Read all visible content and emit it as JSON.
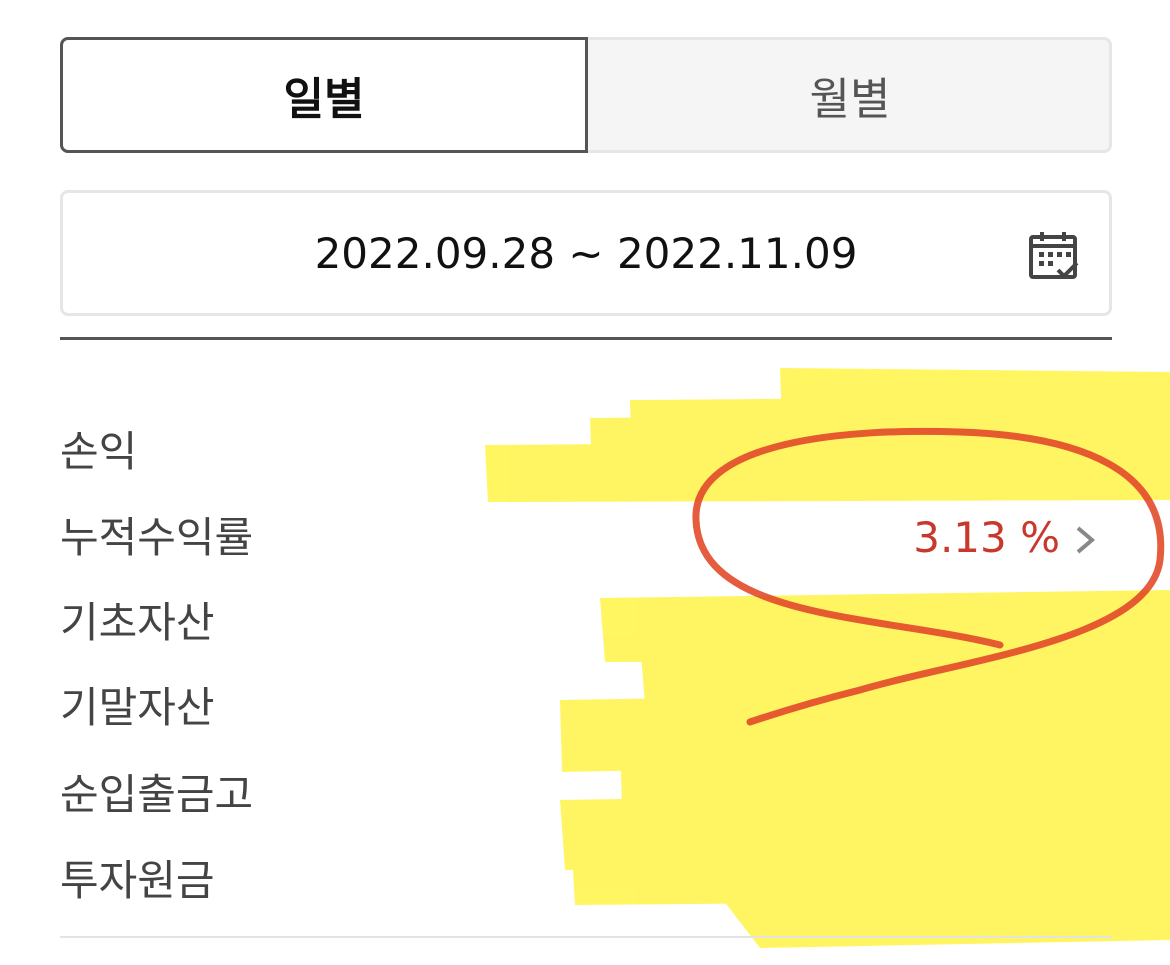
{
  "tabs": {
    "daily": "일별",
    "monthly": "월별"
  },
  "date_range": {
    "text": "2022.09.28 ~ 2022.11.09"
  },
  "rows": [
    {
      "label": "손익"
    },
    {
      "label": "누적수익률",
      "value": "3.13 %"
    },
    {
      "label": "기초자산"
    },
    {
      "label": "기말자산"
    },
    {
      "label": "순입출금고"
    },
    {
      "label": "투자원금"
    }
  ],
  "icons": {
    "calendar": "calendar-check-icon",
    "chevron": "chevron-right-icon"
  },
  "colors": {
    "accent_value": "#c6392c",
    "highlight": "#fff55a",
    "annotation": "#e24a2a"
  }
}
